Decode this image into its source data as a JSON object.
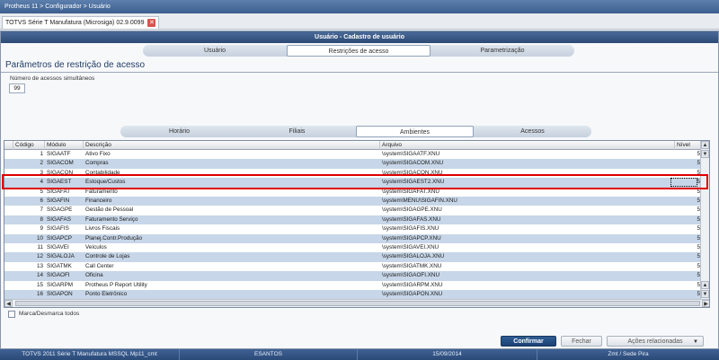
{
  "breadcrumb": "Protheus 11 > Configurador > Usuário",
  "document_tab": {
    "label": "TOTVS Série T Manufatura (Microsiga) 02.9.0099",
    "close_symbol": "✕"
  },
  "window_title": "Usuário - Cadastro de usuário",
  "top_tabs": [
    "Usuário",
    "Restrições de acesso",
    "Parametrização"
  ],
  "active_top_tab": 1,
  "section_title": "Parâmetros de restrição de acesso",
  "simultaneous_access": {
    "label": "Número de acessos simultâneos",
    "value": "99"
  },
  "sub_tabs": [
    "Horário",
    "Filiais",
    "Ambientes",
    "Acessos"
  ],
  "active_sub_tab": 2,
  "grid": {
    "columns": [
      "Código",
      "Módulo",
      "Descrição",
      "Arquivo",
      "Nível"
    ],
    "rows": [
      {
        "codigo": "1",
        "modulo": "SIGAATF",
        "descricao": "Ativo Fixo",
        "arquivo": "\\system\\SIGAATF.XNU",
        "nivel": "5"
      },
      {
        "codigo": "2",
        "modulo": "SIGACOM",
        "descricao": "Compras",
        "arquivo": "\\system\\SIGACOM.XNU",
        "nivel": "5"
      },
      {
        "codigo": "3",
        "modulo": "SIGACON",
        "descricao": "Contabilidade",
        "arquivo": "\\system\\SIGACON.XNU",
        "nivel": "5"
      },
      {
        "codigo": "4",
        "modulo": "SIGAEST",
        "descricao": "Estoque/Custos",
        "arquivo": "\\system\\SIGAEST2.XNU",
        "nivel": "5"
      },
      {
        "codigo": "5",
        "modulo": "SIGAFAT",
        "descricao": "Faturamento",
        "arquivo": "\\system\\SIGAFAT.XNU",
        "nivel": "5"
      },
      {
        "codigo": "6",
        "modulo": "SIGAFIN",
        "descricao": "Financeiro",
        "arquivo": "\\system\\MENU\\SIGAFIN.XNU",
        "nivel": "5"
      },
      {
        "codigo": "7",
        "modulo": "SIGAGPE",
        "descricao": "Gestão de Pessoal",
        "arquivo": "\\system\\SIGAGPE.XNU",
        "nivel": "5"
      },
      {
        "codigo": "8",
        "modulo": "SIGAFAS",
        "descricao": "Faturamento Serviço",
        "arquivo": "\\system\\SIGAFAS.XNU",
        "nivel": "5"
      },
      {
        "codigo": "9",
        "modulo": "SIGAFIS",
        "descricao": "Livros Fiscais",
        "arquivo": "\\system\\SIGAFIS.XNU",
        "nivel": "5"
      },
      {
        "codigo": "10",
        "modulo": "SIGAPCP",
        "descricao": "Planej.Contr.Produção",
        "arquivo": "\\system\\SIGAPCP.XNU",
        "nivel": "5"
      },
      {
        "codigo": "11",
        "modulo": "SIGAVEI",
        "descricao": "Veículos",
        "arquivo": "\\system\\SIGAVEI.XNU",
        "nivel": "5"
      },
      {
        "codigo": "12",
        "modulo": "SIGALOJA",
        "descricao": "Controle de Lojas",
        "arquivo": "\\system\\SIGALOJA.XNU",
        "nivel": "5"
      },
      {
        "codigo": "13",
        "modulo": "SIGATMK",
        "descricao": "Call Center",
        "arquivo": "\\system\\SIGATMK.XNU",
        "nivel": "5"
      },
      {
        "codigo": "14",
        "modulo": "SIGAOFI",
        "descricao": "Oficina",
        "arquivo": "\\system\\SIGAOFI.XNU",
        "nivel": "5"
      },
      {
        "codigo": "15",
        "modulo": "SIGARPM",
        "descricao": "Protheus P Report Utility",
        "arquivo": "\\system\\SIGARPM.XNU",
        "nivel": "5"
      },
      {
        "codigo": "16",
        "modulo": "SIGAPON",
        "descricao": "Ponto Eletrônico",
        "arquivo": "\\system\\SIGAPON.XNU",
        "nivel": "5"
      }
    ],
    "highlighted_row": 3
  },
  "toggle_all_label": "Marca/Desmarca todos",
  "buttons": {
    "confirm": "Confirmar",
    "close": "Fechar",
    "actions": "Ações relacionadas"
  },
  "statusbar": [
    "TOTVS 2011 Série T Manufatura MSSQL Mp11_cmt",
    "ESANTOS",
    "15/09/2014",
    "Zmt / Sede Pira"
  ],
  "colors": {
    "title_bar": "#2c4a75",
    "row_alt": "#c7d6e8",
    "highlight_border": "#e00000",
    "confirm_button": "#1c4176"
  }
}
